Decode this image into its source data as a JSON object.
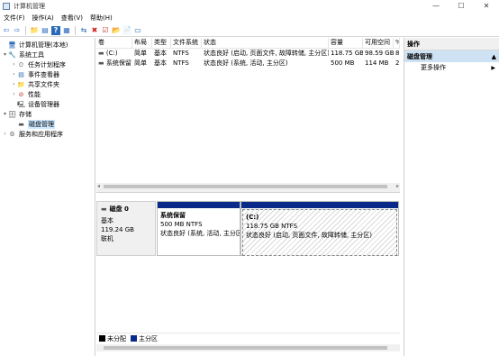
{
  "window": {
    "title": "计算机管理",
    "minimize": "—",
    "maximize": "☐",
    "close": "✕"
  },
  "menu": [
    "文件(F)",
    "操作(A)",
    "查看(V)",
    "帮助(H)"
  ],
  "toolbar": {
    "icons": [
      "back-arrow-icon",
      "forward-arrow-icon",
      "up-folder-icon",
      "show-hide-tree-icon",
      "help-icon",
      "properties-icon",
      "connect-icon",
      "delete-icon",
      "check-icon",
      "new-folder-icon",
      "export-icon",
      "view-icon"
    ],
    "glyphs": [
      "⇦",
      "⇨",
      "📁",
      "▤",
      "?",
      "▦",
      "⇆",
      "✖",
      "☑",
      "📂",
      "📄",
      "▭"
    ]
  },
  "tree": [
    {
      "label": "计算机管理(本地)",
      "arrow": "",
      "icon": "computer-icon",
      "glyph": "🖥",
      "indent": 0
    },
    {
      "label": "系统工具",
      "arrow": "▾",
      "icon": "tools-icon",
      "glyph": "🔧",
      "indent": 1
    },
    {
      "label": "任务计划程序",
      "arrow": "›",
      "icon": "clock-icon",
      "glyph": "⏲",
      "indent": 2
    },
    {
      "label": "事件查看器",
      "arrow": "›",
      "icon": "event-viewer-icon",
      "glyph": "▤",
      "indent": 2
    },
    {
      "label": "共享文件夹",
      "arrow": "›",
      "icon": "shared-folder-icon",
      "glyph": "📁",
      "indent": 2
    },
    {
      "label": "性能",
      "arrow": "›",
      "icon": "performance-icon",
      "glyph": "⊘",
      "indent": 2
    },
    {
      "label": "设备管理器",
      "arrow": "",
      "icon": "device-manager-icon",
      "glyph": "🖳",
      "indent": 2
    },
    {
      "label": "存储",
      "arrow": "▾",
      "icon": "storage-icon",
      "glyph": "🗄",
      "indent": 1
    },
    {
      "label": "磁盘管理",
      "arrow": "",
      "icon": "disk-icon",
      "glyph": "▬",
      "indent": 2,
      "selected": true
    },
    {
      "label": "服务和应用程序",
      "arrow": "›",
      "icon": "services-icon",
      "glyph": "⚙",
      "indent": 1
    }
  ],
  "volumes": {
    "headers": [
      "卷",
      "布局",
      "类型",
      "文件系统",
      "状态",
      "容量",
      "可用空间",
      "%"
    ],
    "rows": [
      [
        "(C:)",
        "简单",
        "基本",
        "NTFS",
        "状态良好 (启动, 页面文件, 故障转储, 主分区)",
        "118.75 GB",
        "98.59 GB",
        "8"
      ],
      [
        "系统保留",
        "简单",
        "基本",
        "NTFS",
        "状态良好 (系统, 活动, 主分区)",
        "500 MB",
        "114 MB",
        "2"
      ]
    ]
  },
  "disk": {
    "name": "磁盘 0",
    "type": "基本",
    "size": "119.24 GB",
    "status": "联机",
    "partitions": [
      {
        "name": "系统保留",
        "size": "500 MB NTFS",
        "status": "状态良好 (系统, 活动, 主分区)"
      },
      {
        "name": "(C:)",
        "size": "118.75 GB NTFS",
        "status": "状态良好 (启动, 页面文件, 故障转储, 主分区)"
      }
    ]
  },
  "legend": [
    {
      "label": "未分配",
      "color": "#000000"
    },
    {
      "label": "主分区",
      "color": "#0a2a8a"
    }
  ],
  "actions": {
    "header": "操作",
    "section": "磁盘管理",
    "section_arrow": "▲",
    "more": "更多操作",
    "more_arrow": "▶"
  },
  "colors": {
    "primary_partition": "#0a2a8a",
    "selection": "#cce8ff",
    "action_section": "#cfe2f3"
  }
}
